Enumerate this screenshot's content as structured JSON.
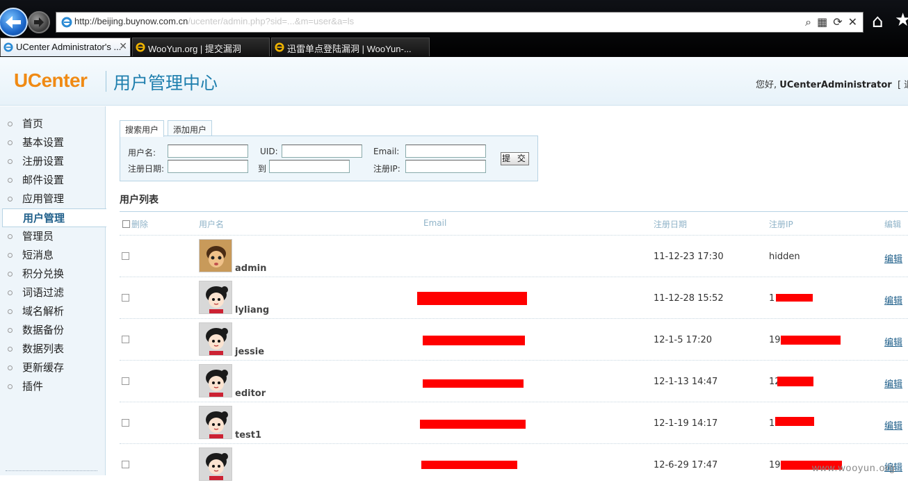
{
  "browser": {
    "url_visible": "http://beijing.buynow.com.cn",
    "url_rest": "/ucenter/admin.php?sid=...&m=user&a=ls",
    "tabs": [
      {
        "label": "UCenter Administrator's ...",
        "active": true
      },
      {
        "label": "WooYun.org | 提交漏洞",
        "active": false
      },
      {
        "label": "迅雷单点登陆漏洞 | WooYun-...",
        "active": false
      }
    ]
  },
  "header": {
    "logo": "UCenter",
    "title": "用户管理中心",
    "greeting_prefix": "您好,",
    "username": "UCenterAdministrator",
    "logout": "[ 退出"
  },
  "sidebar": {
    "items": [
      {
        "label": "首页",
        "active": false
      },
      {
        "label": "基本设置",
        "active": false
      },
      {
        "label": "注册设置",
        "active": false
      },
      {
        "label": "邮件设置",
        "active": false
      },
      {
        "label": "应用管理",
        "active": false
      },
      {
        "label": "用户管理",
        "active": true
      },
      {
        "label": "管理员",
        "active": false
      },
      {
        "label": "短消息",
        "active": false
      },
      {
        "label": "积分兑换",
        "active": false
      },
      {
        "label": "词语过滤",
        "active": false
      },
      {
        "label": "域名解析",
        "active": false
      },
      {
        "label": "数据备份",
        "active": false
      },
      {
        "label": "数据列表",
        "active": false
      },
      {
        "label": "更新缓存",
        "active": false
      },
      {
        "label": "插件",
        "active": false
      }
    ]
  },
  "search": {
    "tabs": [
      "搜索用户",
      "添加用户"
    ],
    "username_label": "用户名:",
    "uid_label": "UID:",
    "email_label": "Email:",
    "regdate_label": "注册日期:",
    "to_label": "到",
    "regip_label": "注册IP:",
    "submit_label": "提 交"
  },
  "list": {
    "title": "用户列表",
    "headers": {
      "delete": "删除",
      "username": "用户名",
      "email": "Email",
      "regdate": "注册日期",
      "regip": "注册IP",
      "edit": "编辑"
    },
    "rows": [
      {
        "username": "admin",
        "date": "11-12-23 17:30",
        "ip": "hidden",
        "edit": "编辑"
      },
      {
        "username": "lyliang",
        "date": "11-12-28 15:52",
        "ip": "1",
        "edit": "编辑"
      },
      {
        "username": "jessie",
        "date": "12-1-5 17:20",
        "ip": "19",
        "edit": "编辑"
      },
      {
        "username": "editor",
        "date": "12-1-13 14:47",
        "ip": "12",
        "edit": "编辑"
      },
      {
        "username": "test1",
        "date": "12-1-19 14:17",
        "ip": "1",
        "edit": "编辑"
      },
      {
        "username": "",
        "date": "12-6-29 17:47",
        "ip": "19",
        "edit": "编辑"
      }
    ]
  },
  "watermark": "www.wooyun.org",
  "colors": {
    "logo_orange": "#f08a14",
    "title_blue": "#1f7fae",
    "redaction": "#ff0000"
  }
}
